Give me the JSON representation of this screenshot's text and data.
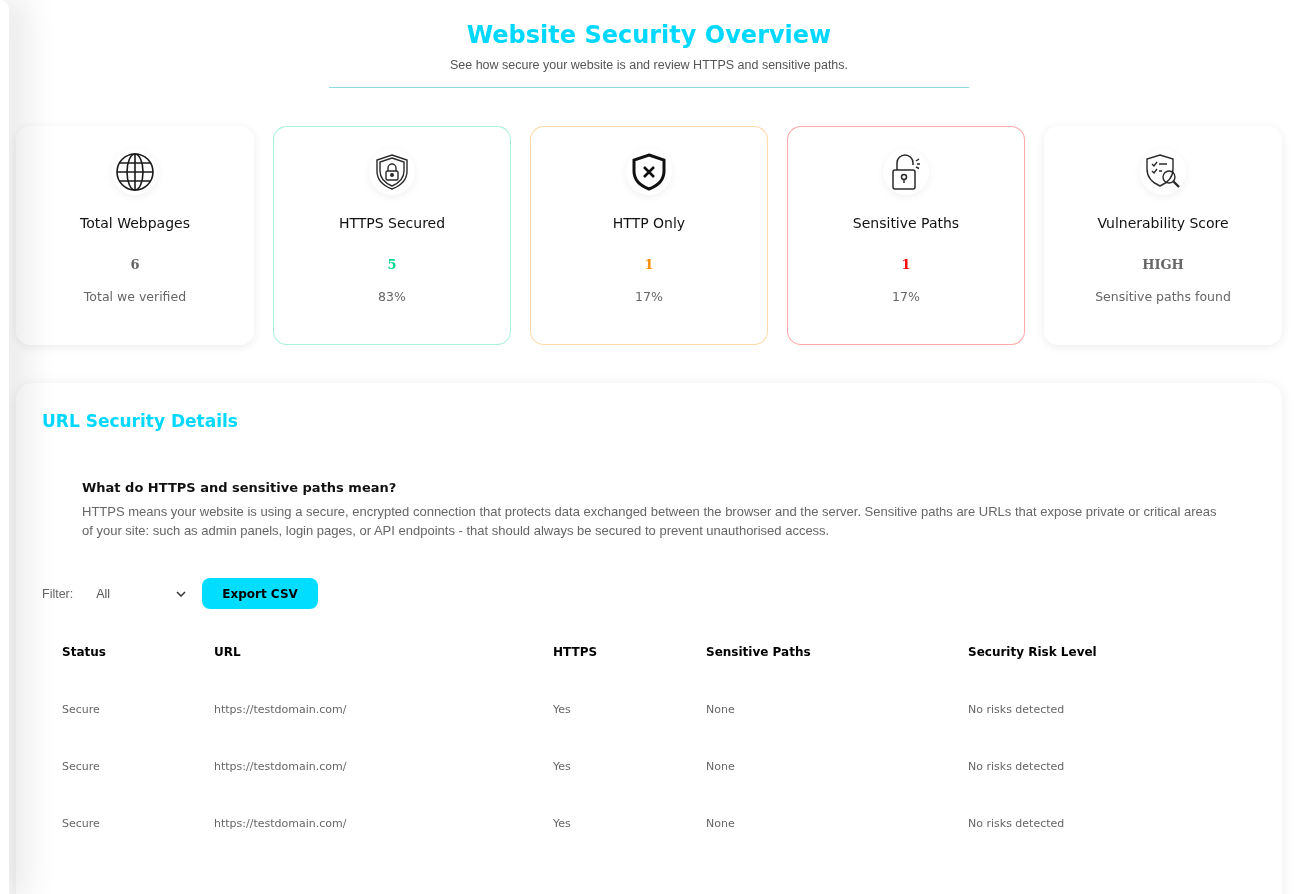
{
  "header": {
    "title": "Website Security Overview",
    "subtitle": "See how secure your website is and review HTTPS and sensitive paths."
  },
  "stats": [
    {
      "label": "Total Webpages",
      "value": "6",
      "note": "Total we verified",
      "color": "#666666",
      "highlighted": false
    },
    {
      "label": "HTTPS Secured",
      "value": "5",
      "note": "83%",
      "color": "#00d98b",
      "highlighted": true
    },
    {
      "label": "HTTP Only",
      "value": "1",
      "note": "17%",
      "color": "#ff8c00",
      "highlighted": true
    },
    {
      "label": "Sensitive Paths",
      "value": "1",
      "note": "17%",
      "color": "#ff0000",
      "highlighted": true
    },
    {
      "label": "Vulnerability Score",
      "value": "HIGH",
      "note": "Sensitive paths found",
      "color": "#666666",
      "highlighted": false
    }
  ],
  "details": {
    "title": "URL Security Details",
    "info": {
      "heading": "What do HTTPS and sensitive paths mean?",
      "text": "HTTPS means your website is using a secure, encrypted connection that protects data exchanged between the browser and the server. Sensitive paths are URLs that expose private or critical areas of your site: such as admin panels, login pages, or API endpoints - that should always be secured to prevent unauthorised access."
    },
    "filter": {
      "label": "Filter:",
      "value": "All"
    },
    "export_button": "Export CSV",
    "table": {
      "columns": [
        "Status",
        "URL",
        "HTTPS",
        "Sensitive Paths",
        "Security Risk Level"
      ],
      "rows": [
        [
          "Secure",
          "https://testdomain.com/",
          "Yes",
          "None",
          "No risks detected"
        ],
        [
          "Secure",
          "https://testdomain.com/",
          "Yes",
          "None",
          "No risks detected"
        ],
        [
          "Secure",
          "https://testdomain.com/",
          "Yes",
          "None",
          "No risks detected"
        ]
      ]
    }
  }
}
